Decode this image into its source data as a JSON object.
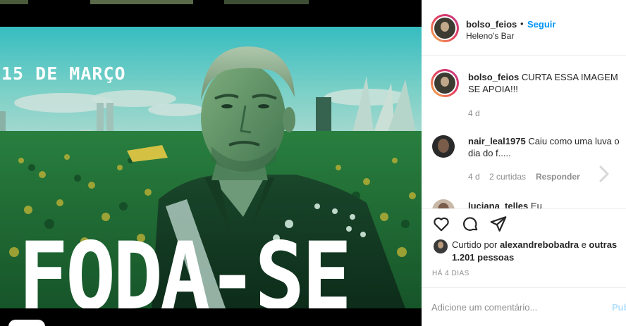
{
  "image": {
    "event_title": "15 DE MARÇO",
    "headline": "FODA-SE",
    "user_tag_icon": "user-tag-icon"
  },
  "post": {
    "username": "bolso_feios",
    "follow_separator": "•",
    "follow_label": "Seguir",
    "location": "Heleno's Bar"
  },
  "caption": {
    "username": "bolso_feios",
    "text": "CURTA ESSA IMAGEM SE APOIA!!!",
    "time": "4 d"
  },
  "comments": [
    {
      "username": "nair_leal1975",
      "text": "Caiu como uma luva o dia do f.....",
      "time": "4 d",
      "likes": "2 curtidas",
      "reply_label": "Responder"
    },
    {
      "username": "luciana_telles",
      "text": "Eu"
    }
  ],
  "actions": {
    "like_icon": "heart-icon",
    "comment_icon": "comment-icon",
    "share_icon": "share-icon"
  },
  "likes": {
    "prefix": "Curtido por",
    "user": "alexandrebobadra",
    "conj": "e",
    "others": "outras 1.201 pessoas"
  },
  "posted_ago": "HÁ 4 DIAS",
  "add_comment": {
    "placeholder": "Adicione um comentário...",
    "publish_label": "Publicar"
  },
  "colors": {
    "accent": "#0095f6",
    "text": "#262626",
    "muted": "#8e8e8e",
    "image_tint": "#1f8a5c"
  }
}
